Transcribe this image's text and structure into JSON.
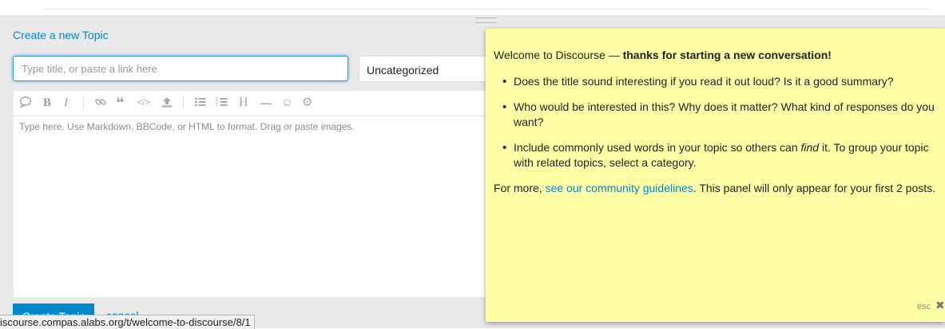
{
  "composer": {
    "title": "Create a new Topic",
    "title_placeholder": "Type title, or paste a link here",
    "category": "Uncategorized",
    "editor_placeholder": "Type here. Use Markdown, BBCode, or HTML to format. Drag or paste images.",
    "toolbar": [
      {
        "name": "quote-icon",
        "glyph": "💬"
      },
      {
        "name": "bold-icon",
        "glyph": "B"
      },
      {
        "name": "italic-icon",
        "glyph": "I"
      },
      {
        "name": "link-icon",
        "glyph": "🔗"
      },
      {
        "name": "blockquote-icon",
        "glyph": "❝"
      },
      {
        "name": "code-icon",
        "glyph": "</>"
      },
      {
        "name": "upload-icon",
        "glyph": "⇪"
      },
      {
        "name": "bullet-list-icon",
        "glyph": "≣"
      },
      {
        "name": "numbered-list-icon",
        "glyph": "≡"
      },
      {
        "name": "heading-icon",
        "glyph": "H"
      },
      {
        "name": "horizontal-rule-icon",
        "glyph": "—"
      },
      {
        "name": "emoji-icon",
        "glyph": "☺"
      },
      {
        "name": "options-gear-icon",
        "glyph": "⚙"
      }
    ],
    "create_button": "Create Topic",
    "cancel": "cancel"
  },
  "education": {
    "intro_prefix": "Welcome to Discourse — ",
    "intro_bold": "thanks for starting a new conversation!",
    "bullets": [
      "Does the title sound interesting if you read it out loud? Is it a good summary?",
      "Who would be interested in this? Why does it matter? What kind of responses do you want?"
    ],
    "bullet3_before": "Include commonly used words in your topic so others can ",
    "bullet3_em": "find",
    "bullet3_after": " it. To group your topic with related topics, select a category.",
    "more_prefix": "For more, ",
    "more_link": "see our community guidelines",
    "more_suffix": ". This panel will only appear for your first 2 posts.",
    "esc": "esc",
    "close_glyph": "✖"
  },
  "status_bar": {
    "url": "iscourse.compas.alabs.org/t/welcome-to-discourse/8/1"
  },
  "colors": {
    "accent": "#0088cc",
    "panel": "#ffffa6",
    "composer_bg": "#e9e9e9"
  }
}
